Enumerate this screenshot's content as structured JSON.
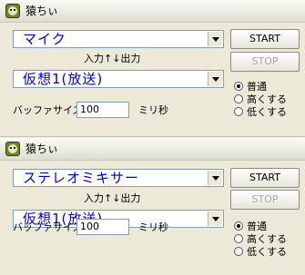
{
  "windows": [
    {
      "title": "猿ちぃ",
      "input_device": "マイク",
      "io_label": "入力↑↓出力",
      "output_device": "仮想1(放送)",
      "start_label": "START",
      "stop_label": "STOP",
      "buffer_label": "バッファサイズ",
      "buffer_value": "100",
      "buffer_unit": "ミリ秒",
      "priority": [
        {
          "label": "普通",
          "checked": true
        },
        {
          "label": "高くする",
          "checked": false
        },
        {
          "label": "低くする",
          "checked": false
        }
      ]
    },
    {
      "title": "猿ちぃ",
      "input_device": "ステレオミキサー",
      "io_label": "入力↑↓出力",
      "output_device": "仮想1(放送)",
      "start_label": "START",
      "stop_label": "STOP",
      "buffer_label": "バッファサイズ",
      "buffer_value": "100",
      "buffer_unit": "ミリ秒",
      "priority": [
        {
          "label": "普通",
          "checked": true
        },
        {
          "label": "高くする",
          "checked": false
        },
        {
          "label": "低くする",
          "checked": false
        }
      ]
    }
  ],
  "colors": {
    "device_text": "#0000c8",
    "window_bg": "#ece9d8",
    "disabled_text": "#aca899"
  }
}
